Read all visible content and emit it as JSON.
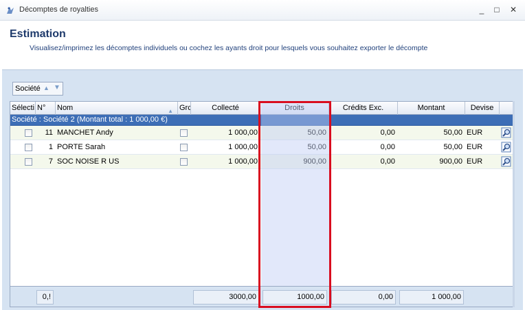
{
  "window": {
    "title": "Décomptes de royalties",
    "controls": {
      "minimize": "_",
      "maximize": "□",
      "close": "✕"
    }
  },
  "header": {
    "title": "Estimation",
    "subtitle": "Visualisez/imprimez les décomptes individuels ou cochez les ayants droit pour lesquels vous souhaitez exporter le décompte"
  },
  "group_panel": {
    "label": "Société"
  },
  "grid": {
    "columns": {
      "select": "Sélecti",
      "num": "N°",
      "name": "Nom",
      "group": "Grc",
      "collecte": "Collecté",
      "droits": "Droits",
      "credits": "Crédits Exc.",
      "montant": "Montant",
      "devise": "Devise"
    },
    "group_row": "Société : Société 2 (Montant total : 1 000,00 €)",
    "rows": [
      {
        "num": "11",
        "name": "MANCHET Andy",
        "collecte": "1 000,00",
        "droits": "50,00",
        "credits": "0,00",
        "montant": "50,00",
        "devise": "EUR"
      },
      {
        "num": "1",
        "name": "PORTE Sarah",
        "collecte": "1 000,00",
        "droits": "50,00",
        "credits": "0,00",
        "montant": "50,00",
        "devise": "EUR"
      },
      {
        "num": "7",
        "name": "SOC NOISE R US",
        "collecte": "1 000,00",
        "droits": "900,00",
        "credits": "0,00",
        "montant": "900,00",
        "devise": "EUR"
      }
    ],
    "footer": {
      "count": "0,!",
      "collecte": "3000,00",
      "droits": "1000,00",
      "credits": "0,00",
      "montant": "1 000,00"
    }
  },
  "colors": {
    "title": "#1e3a6b",
    "group_row": "#3d6eb6",
    "highlight": "#d90d1f",
    "droits_column": "#becbf4"
  }
}
